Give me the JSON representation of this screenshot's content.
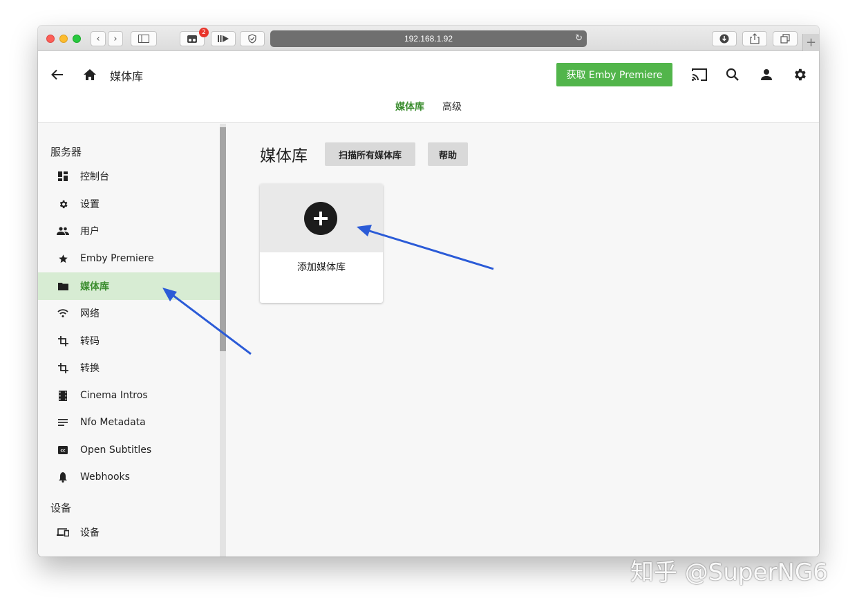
{
  "browser": {
    "url": "192.168.1.92",
    "extension_badge": "2"
  },
  "header": {
    "title": "媒体库",
    "premiere_button": "获取 Emby Premiere",
    "tabs": [
      {
        "label": "媒体库",
        "active": true
      },
      {
        "label": "高级",
        "active": false
      }
    ]
  },
  "sidebar": {
    "sections": [
      {
        "title": "服务器",
        "items": [
          {
            "label": "控制台",
            "icon": "dashboard-icon"
          },
          {
            "label": "设置",
            "icon": "gear-icon"
          },
          {
            "label": "用户",
            "icon": "users-icon"
          },
          {
            "label": "Emby Premiere",
            "icon": "star-icon"
          },
          {
            "label": "媒体库",
            "icon": "folder-icon",
            "active": true
          },
          {
            "label": "网络",
            "icon": "wifi-icon"
          },
          {
            "label": "转码",
            "icon": "crop-icon"
          },
          {
            "label": "转换",
            "icon": "crop-icon"
          },
          {
            "label": "Cinema Intros",
            "icon": "film-icon"
          },
          {
            "label": "Nfo Metadata",
            "icon": "lines-icon"
          },
          {
            "label": "Open Subtitles",
            "icon": "cc-icon"
          },
          {
            "label": "Webhooks",
            "icon": "bell-icon"
          }
        ]
      },
      {
        "title": "设备",
        "items": [
          {
            "label": "设备",
            "icon": "devices-icon"
          }
        ]
      }
    ]
  },
  "main": {
    "title": "媒体库",
    "scan_button": "扫描所有媒体库",
    "help_button": "帮助",
    "add_card_label": "添加媒体库"
  },
  "watermark": "知乎 @SuperNG6",
  "colors": {
    "accent": "#52b54b",
    "active_text": "#3b8d2f",
    "active_bg": "#d7ecd3",
    "annotation_arrow": "#2b5bd7"
  }
}
